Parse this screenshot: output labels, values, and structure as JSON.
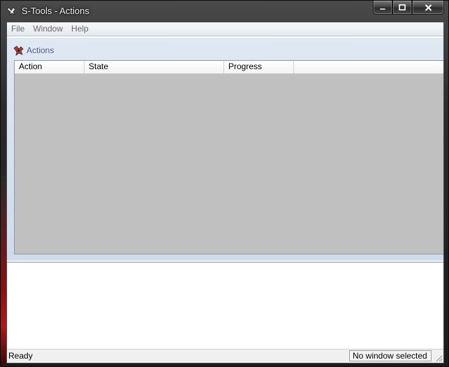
{
  "window": {
    "title": "S-Tools - Actions",
    "icons": {
      "app": "s-tools-app-icon",
      "minimize": "minimize-icon",
      "maximize": "maximize-icon",
      "close": "close-icon"
    }
  },
  "menu": [
    {
      "label": "File"
    },
    {
      "label": "Window"
    },
    {
      "label": "Help"
    }
  ],
  "actions_panel": {
    "title": "Actions",
    "icon": "actions-icon",
    "columns": [
      "Action",
      "State",
      "Progress"
    ]
  },
  "status": {
    "left": "Ready",
    "right": "No window selected"
  },
  "colors": {
    "grid_background": "#c0c0c0",
    "panel_title": "#4d6185"
  }
}
